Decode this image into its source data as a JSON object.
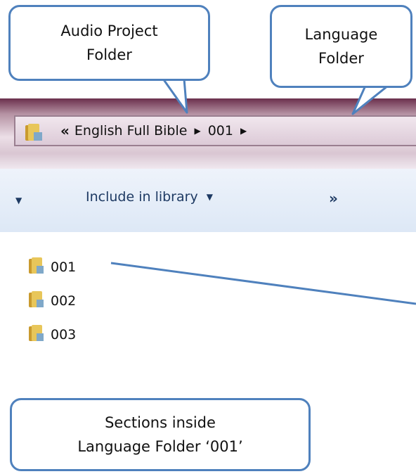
{
  "callouts": {
    "audio_project": {
      "line1": "Audio Project",
      "line2": "Folder"
    },
    "language": {
      "line1": "Language",
      "line2": "Folder"
    },
    "sections": {
      "line1": "Sections inside",
      "line2": "Language Folder ‘001’"
    }
  },
  "address_bar": {
    "overflow_glyph": "«",
    "crumbs": [
      "English Full Bible",
      "001"
    ],
    "separator_glyph": "▶"
  },
  "toolbar": {
    "include_label": "Include in library",
    "more_glyph": "»"
  },
  "folders": [
    {
      "name": "001"
    },
    {
      "name": "002"
    },
    {
      "name": "003"
    }
  ],
  "colors": {
    "callout_border": "#4f81bd",
    "folder_body": "#e8c65a",
    "folder_dark": "#c99a2e"
  },
  "icons": {
    "folder": "folder-icon",
    "separator": "chevron-right-icon",
    "dropdown": "caret-down-icon"
  }
}
